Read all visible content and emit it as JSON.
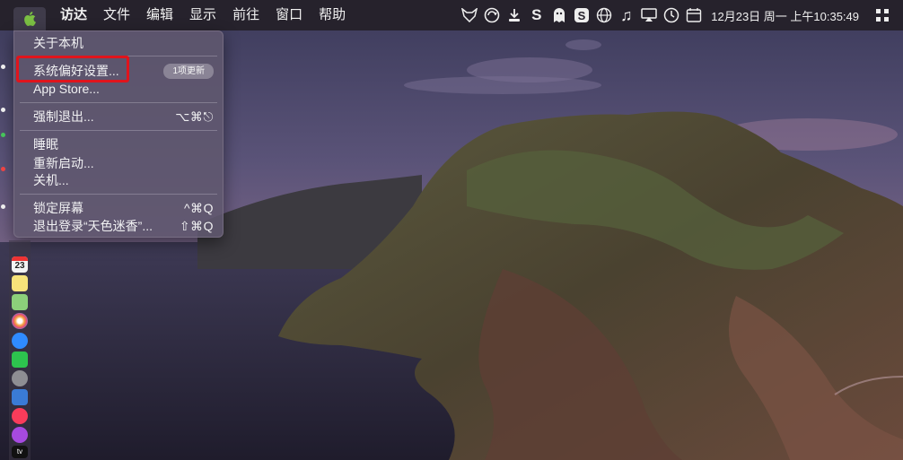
{
  "menubar": {
    "apple_icon": "apple-logo-icon",
    "items": [
      "访达",
      "文件",
      "编辑",
      "显示",
      "前往",
      "窗口",
      "帮助"
    ],
    "status_icons": [
      "fox-icon",
      "sync-icon",
      "download-icon",
      "s-icon",
      "ghost-icon",
      "s-box-icon",
      "globe-icon",
      "music-icon",
      "airplay-icon",
      "time-machine-icon",
      "calendar-icon"
    ],
    "clock": "12月23日 周一 上午10:35:49",
    "right_icon": "grid-icon"
  },
  "apple_menu": {
    "about": "关于本机",
    "system_prefs": "系统偏好设置...",
    "system_prefs_badge": "1项更新",
    "app_store": "App Store...",
    "force_quit": "强制退出...",
    "force_quit_shortcut": "⌥⌘⎋",
    "sleep": "睡眠",
    "restart": "重新启动...",
    "shutdown": "关机...",
    "lock_screen": "锁定屏幕",
    "lock_screen_shortcut": "^⌘Q",
    "logout": "退出登录“天色迷香”...",
    "logout_shortcut": "⇧⌘Q"
  },
  "dock": {
    "calendar_day": "23",
    "apps": [
      "calendar-icon",
      "notes-icon",
      "maps-icon",
      "photos-icon",
      "messages-icon",
      "facetime-icon",
      "system-preferences-icon",
      "keynote-icon",
      "music-icon",
      "podcasts-icon",
      "tv-icon"
    ],
    "tv_label": "tv"
  },
  "colors": {
    "highlight": "#e0141c",
    "menubar_bg": "#26222c",
    "menu_bg": "#60586e"
  }
}
